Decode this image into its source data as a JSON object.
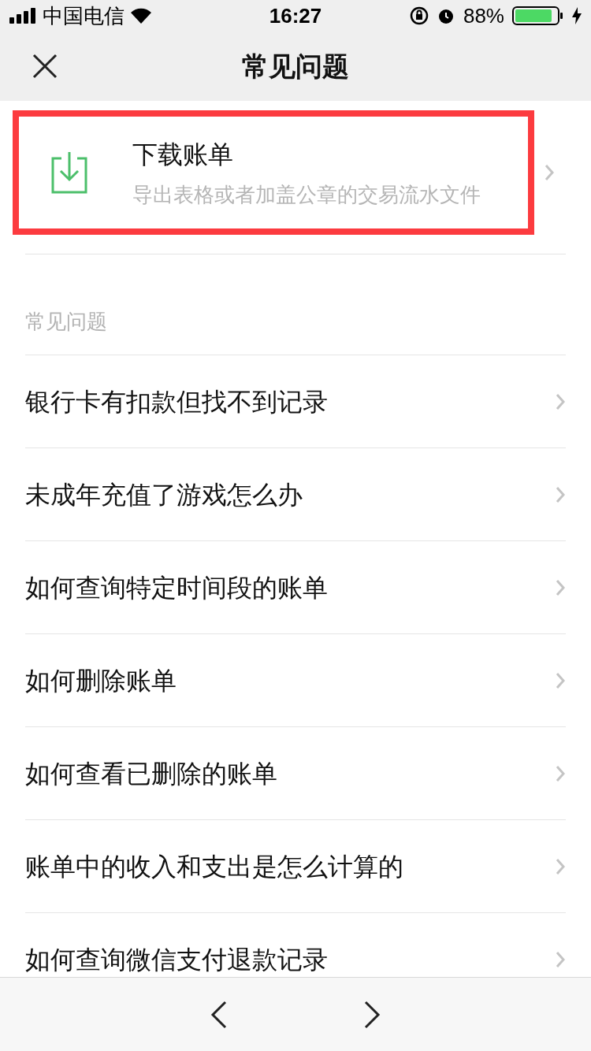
{
  "status_bar": {
    "carrier": "中国电信",
    "time": "16:27",
    "battery": "88%"
  },
  "nav": {
    "title": "常见问题"
  },
  "download": {
    "title": "下载账单",
    "subtitle": "导出表格或者加盖公章的交易流水文件",
    "highlighted": true
  },
  "section": {
    "header": "常见问题",
    "items": [
      {
        "label": "银行卡有扣款但找不到记录"
      },
      {
        "label": "未成年充值了游戏怎么办"
      },
      {
        "label": "如何查询特定时间段的账单"
      },
      {
        "label": "如何删除账单"
      },
      {
        "label": "如何查看已删除的账单"
      },
      {
        "label": "账单中的收入和支出是怎么计算的"
      },
      {
        "label": "如何查询微信支付退款记录"
      }
    ]
  }
}
